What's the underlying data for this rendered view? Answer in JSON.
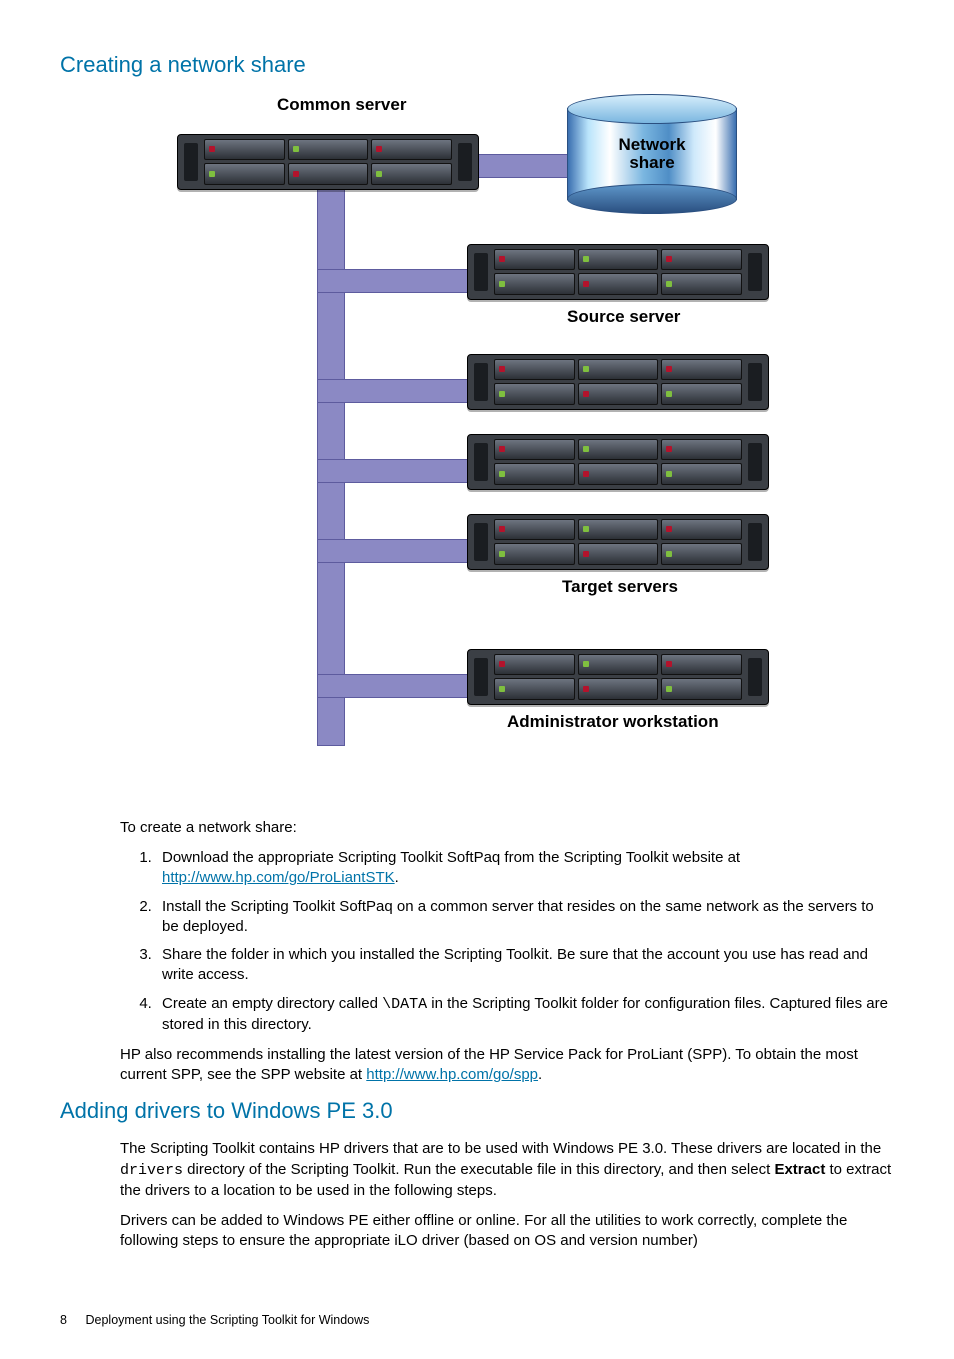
{
  "section1_title": "Creating a network share",
  "diagram": {
    "common_server": "Common server",
    "network_share_l1": "Network",
    "network_share_l2": "share",
    "source_server": "Source server",
    "target_servers": "Target servers",
    "admin_workstation": "Administrator workstation"
  },
  "intro": "To create a network share:",
  "steps": {
    "s1a": "Download the appropriate Scripting Toolkit SoftPaq from the Scripting Toolkit website at ",
    "s1_link": "http://www.hp.com/go/ProLiantSTK",
    "s1b": ".",
    "s2": "Install the Scripting Toolkit SoftPaq on a common server that resides on the same network as the servers to be deployed.",
    "s3": "Share the folder in which you installed the Scripting Toolkit. Be sure that the account you use has read and write access.",
    "s4a": "Create an empty directory called ",
    "s4_code": "\\DATA",
    "s4b": " in the Scripting Toolkit folder for configuration files. Captured files are stored in this directory."
  },
  "spp_a": "HP also recommends installing the latest version of the HP Service Pack for ProLiant (SPP). To obtain the most current SPP, see the SPP website at ",
  "spp_link": "http://www.hp.com/go/spp",
  "spp_b": ".",
  "section2_title": "Adding drivers to Windows PE 3.0",
  "p2a": "The Scripting Toolkit contains HP drivers that are to be used with Windows PE 3.0. These drivers are located in the ",
  "p2_code": "drivers",
  "p2b": " directory of the Scripting Toolkit. Run the executable file in this directory, and then select ",
  "p2_bold": "Extract",
  "p2c": " to extract the drivers to a location to be used in the following steps.",
  "p3": "Drivers can be added to Windows PE either offline or online. For all the utilities to work correctly, complete the following steps to ensure the appropriate iLO driver (based on OS and version number)",
  "footer": {
    "page": "8",
    "title": "Deployment using the Scripting Toolkit for Windows"
  }
}
